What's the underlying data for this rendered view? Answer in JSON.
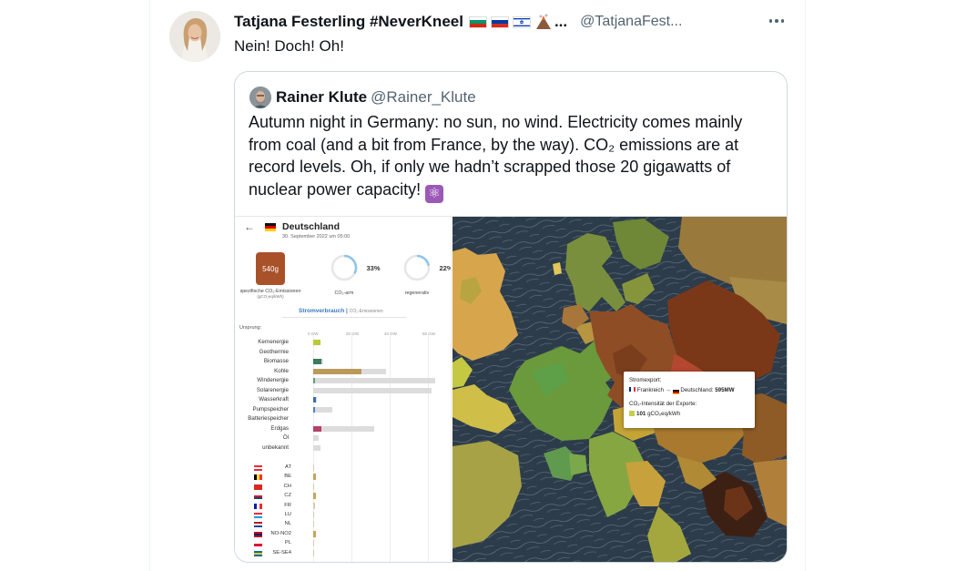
{
  "tweet": {
    "author_name": "Tatjana Festerling #NeverKneel",
    "name_ellipsis": "...",
    "handle": "@TatjanaFest...",
    "text": "Nein! Doch! Oh!",
    "more_icon": "more-horizontal-icon"
  },
  "quote": {
    "author_name": "Rainer Klute",
    "handle": "@Rainer_Klute",
    "text": "Autumn night in Germany: no sun, no wind. Electricity comes mainly from coal (and a bit from France, by the way). CO₂ emissions are at record levels. Oh, if only we hadn’t scrapped those 20 gigawatts of nuclear power capacity!",
    "emoji": "⚛"
  },
  "panel": {
    "back": "←",
    "country": "Deutschland",
    "date": "30. September 2022 um 05:00",
    "co2_value": "540g",
    "co2_label": "spezifische CO₂-Emissionen",
    "co2_unit": "(gCO₂eq/kWh)",
    "low_carbon_value": "33%",
    "low_carbon_label": "CO₂-arm",
    "renewable_value": "22%",
    "renewable_label": "regenerativ",
    "tab_active": "Stromverbrauch",
    "tab_other": "CO₂-Emissionen",
    "origin_label": "Ursprung:",
    "gw_ticks": [
      "0 GW",
      "20 GW",
      "40 GW",
      "60 GW"
    ],
    "low_carbon_fraction": 0.33,
    "renewable_fraction": 0.22
  },
  "chart_data": {
    "type": "bar",
    "unit": "GW",
    "categories": [
      "Kernenergie",
      "Geothermie",
      "Biomasse",
      "Kohle",
      "Windenergie",
      "Solarenergie",
      "Wasserkraft",
      "Pumpspeicher",
      "Batteriespeicher",
      "Erdgas",
      "Öl",
      "unbekannt"
    ],
    "values": [
      4,
      0,
      4.5,
      25,
      1,
      0,
      1.5,
      0.8,
      0,
      4.5,
      0,
      0
    ],
    "capacity": [
      4,
      0,
      5,
      38,
      64,
      62,
      2,
      10,
      0,
      32,
      3,
      4
    ],
    "colors": [
      "#b8c93a",
      "#999999",
      "#3b7a5b",
      "#b99a5a",
      "#5aa574",
      "#e6c532",
      "#3a6fb4",
      "#4d7fc2",
      "#888888",
      "#b2426b",
      "#666666",
      "#aaaaaa"
    ],
    "exchange_countries": [
      "AT",
      "BE",
      "CH",
      "CZ",
      "FR",
      "LU",
      "NL",
      "NO-NO2",
      "PL",
      "SE-SE4"
    ],
    "exchange_values": [
      0,
      1.2,
      0.5,
      1.5,
      0.8,
      0,
      0,
      1.5,
      0.5,
      0.5
    ],
    "xlim": [
      0,
      60
    ]
  },
  "map": {
    "tooltip_title": "Stromexport:",
    "tooltip_from": "Frankreich",
    "tooltip_arrow": "→",
    "tooltip_to": "Deutschland:",
    "tooltip_value": "595MW",
    "tooltip_sub": "CO₂-Intensität der Exporte:",
    "tooltip_intensity": "101",
    "tooltip_intensity_unit": "gCO₂eq/kWh"
  }
}
